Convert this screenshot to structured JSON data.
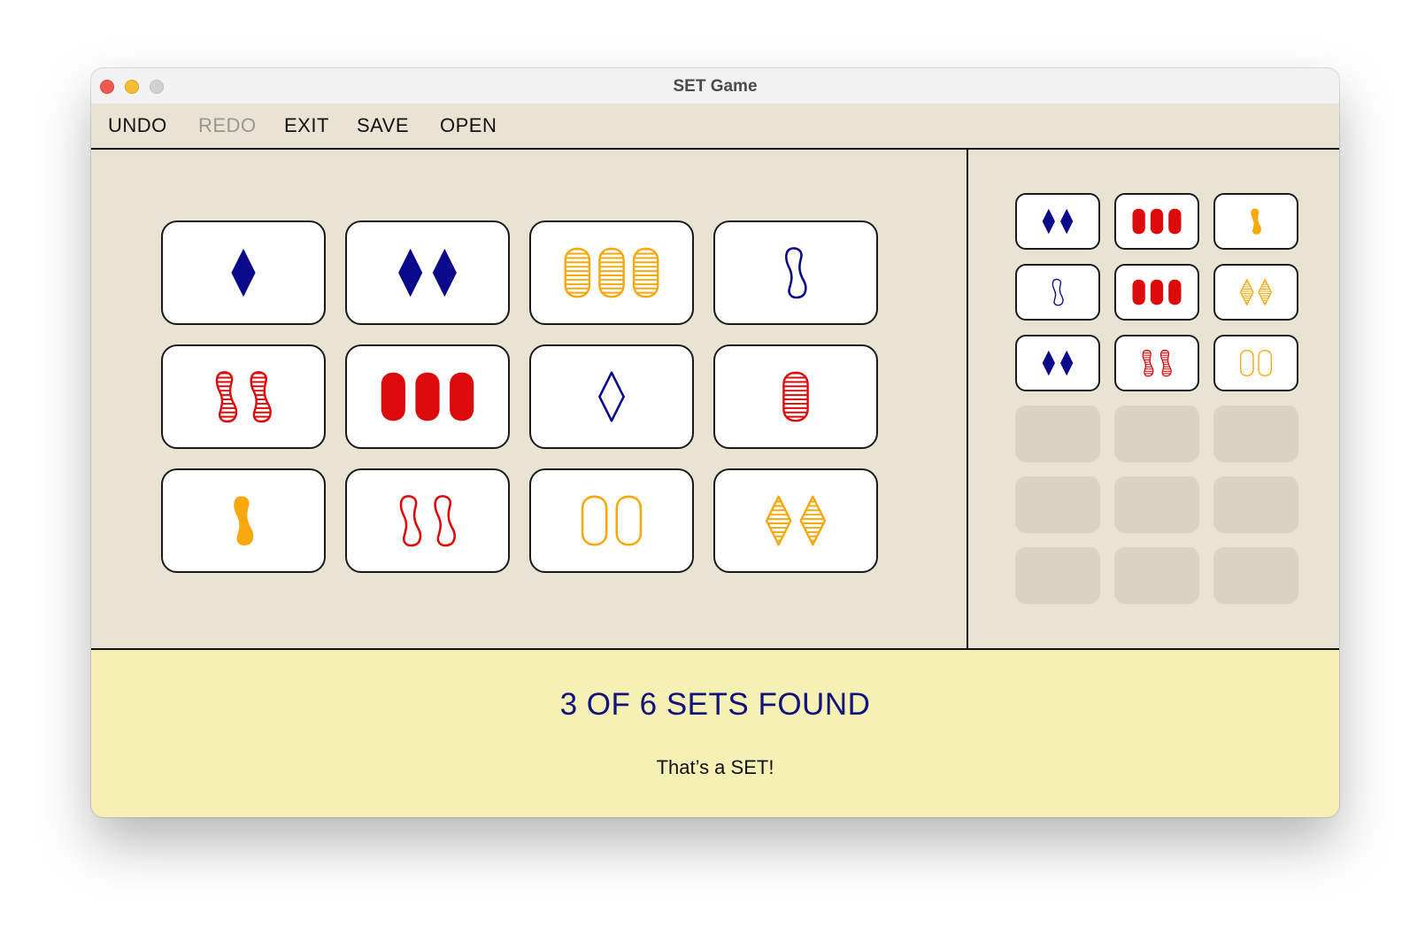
{
  "window": {
    "title": "SET Game"
  },
  "menu": [
    {
      "label": "UNDO",
      "enabled": true
    },
    {
      "label": "REDO",
      "enabled": false
    },
    {
      "label": "EXIT",
      "enabled": true
    },
    {
      "label": "SAVE",
      "enabled": true
    },
    {
      "label": "OPEN",
      "enabled": true
    }
  ],
  "colors": {
    "blue": "#0a0a8a",
    "red": "#dc0a0a",
    "yellow": "#f7a80c",
    "status_text": "#12127e"
  },
  "board": {
    "cards": [
      {
        "count": 1,
        "shape": "diamond",
        "color": "blue",
        "fill": "solid"
      },
      {
        "count": 2,
        "shape": "diamond",
        "color": "blue",
        "fill": "solid"
      },
      {
        "count": 3,
        "shape": "oval",
        "color": "yellow",
        "fill": "striped"
      },
      {
        "count": 1,
        "shape": "squiggle",
        "color": "blue",
        "fill": "open"
      },
      {
        "count": 2,
        "shape": "squiggle",
        "color": "red",
        "fill": "striped"
      },
      {
        "count": 3,
        "shape": "oval",
        "color": "red",
        "fill": "solid"
      },
      {
        "count": 1,
        "shape": "diamond",
        "color": "blue",
        "fill": "open"
      },
      {
        "count": 1,
        "shape": "oval",
        "color": "red",
        "fill": "striped"
      },
      {
        "count": 1,
        "shape": "squiggle",
        "color": "yellow",
        "fill": "solid"
      },
      {
        "count": 2,
        "shape": "squiggle",
        "color": "red",
        "fill": "open"
      },
      {
        "count": 2,
        "shape": "oval",
        "color": "yellow",
        "fill": "open"
      },
      {
        "count": 2,
        "shape": "diamond",
        "color": "yellow",
        "fill": "striped"
      }
    ]
  },
  "found_sets": {
    "cards": [
      {
        "count": 2,
        "shape": "diamond",
        "color": "blue",
        "fill": "solid"
      },
      {
        "count": 3,
        "shape": "oval",
        "color": "red",
        "fill": "solid"
      },
      {
        "count": 1,
        "shape": "squiggle",
        "color": "yellow",
        "fill": "solid"
      },
      {
        "count": 1,
        "shape": "squiggle",
        "color": "blue",
        "fill": "open"
      },
      {
        "count": 3,
        "shape": "oval",
        "color": "red",
        "fill": "solid"
      },
      {
        "count": 2,
        "shape": "diamond",
        "color": "yellow",
        "fill": "striped"
      },
      {
        "count": 2,
        "shape": "diamond",
        "color": "blue",
        "fill": "solid"
      },
      {
        "count": 2,
        "shape": "squiggle",
        "color": "red",
        "fill": "striped"
      },
      {
        "count": 2,
        "shape": "oval",
        "color": "yellow",
        "fill": "open"
      }
    ],
    "empty_slots": 9
  },
  "status": {
    "title": "3 OF 6 SETS FOUND",
    "message": "That’s a SET!"
  }
}
